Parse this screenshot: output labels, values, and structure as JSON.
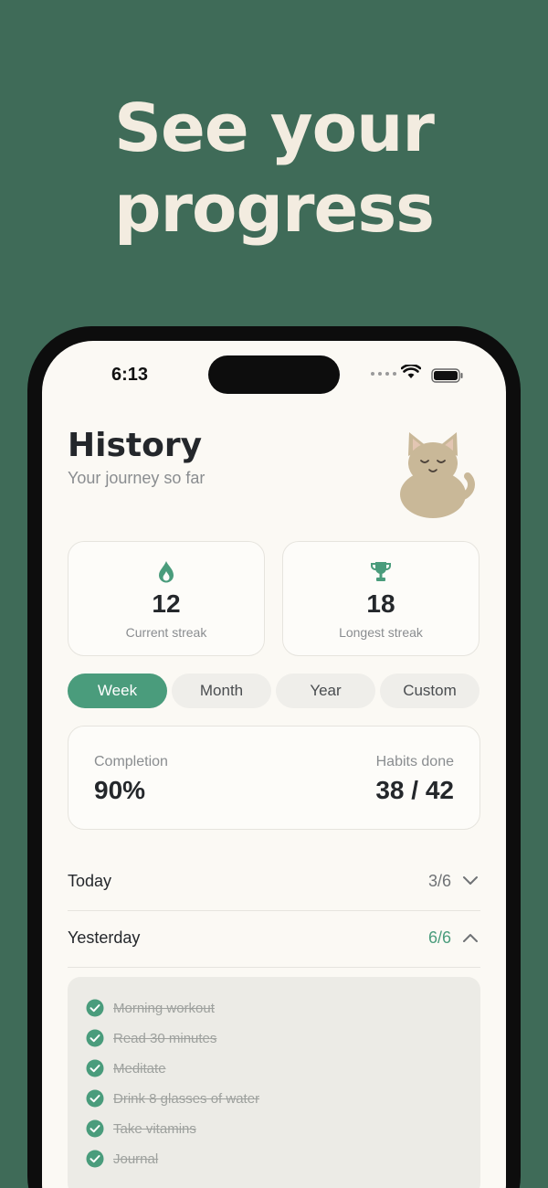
{
  "headline": {
    "line1": "See your",
    "line2": "progress"
  },
  "status_bar": {
    "time": "6:13"
  },
  "header": {
    "title": "History",
    "subtitle": "Your journey so far"
  },
  "streaks": [
    {
      "value": "12",
      "label": "Current streak",
      "icon": "flame-icon"
    },
    {
      "value": "18",
      "label": "Longest streak",
      "icon": "trophy-icon"
    }
  ],
  "period_tabs": [
    {
      "label": "Week",
      "active": true
    },
    {
      "label": "Month",
      "active": false
    },
    {
      "label": "Year",
      "active": false
    },
    {
      "label": "Custom",
      "active": false
    }
  ],
  "summary": {
    "completion_label": "Completion",
    "completion_value": "90%",
    "habits_label": "Habits done",
    "habits_value": "38 / 42"
  },
  "days": [
    {
      "name": "Today",
      "count": "3/6",
      "expanded": false
    },
    {
      "name": "Yesterday",
      "count": "6/6",
      "expanded": true
    }
  ],
  "habits": [
    {
      "label": "Morning workout",
      "done": true
    },
    {
      "label": "Read 30 minutes",
      "done": true
    },
    {
      "label": "Meditate",
      "done": true
    },
    {
      "label": "Drink 8 glasses of water",
      "done": true
    },
    {
      "label": "Take vitamins",
      "done": true
    },
    {
      "label": "Journal",
      "done": true
    }
  ],
  "colors": {
    "background": "#3f6b58",
    "accent": "#4a9c7c",
    "headline": "#f3ece0",
    "screen": "#fbf9f4"
  }
}
